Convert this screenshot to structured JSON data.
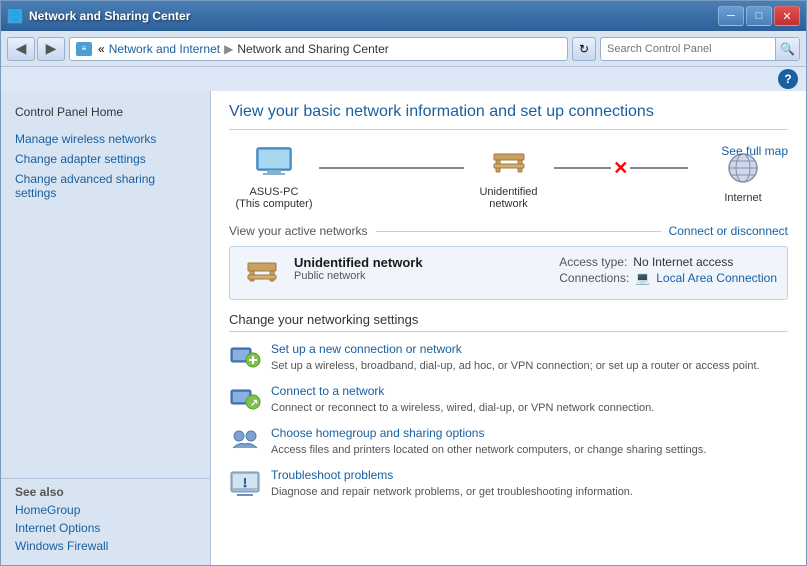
{
  "window": {
    "title": "Network and Sharing Center",
    "icon": "🌐",
    "controls": {
      "minimize": "─",
      "maximize": "□",
      "close": "✕"
    }
  },
  "addressbar": {
    "back": "◀",
    "forward": "▶",
    "breadcrumb": [
      "Network and Internet",
      "Network and Sharing Center"
    ],
    "refresh": "↻",
    "search_placeholder": "Search Control Panel"
  },
  "help": "?",
  "sidebar": {
    "home_label": "Control Panel Home",
    "links": [
      "Manage wireless networks",
      "Change adapter settings",
      "Change advanced sharing settings"
    ],
    "see_also": "See also",
    "bottom_links": [
      "HomeGroup",
      "Internet Options",
      "Windows Firewall"
    ]
  },
  "content": {
    "title": "View your basic network information and set up connections",
    "diagram": {
      "nodes": [
        {
          "label": "ASUS-PC\n(This computer)",
          "type": "computer"
        },
        {
          "label": "Unidentified network",
          "type": "network"
        },
        {
          "label": "Internet",
          "type": "globe"
        }
      ],
      "connections": [
        "line",
        "broken"
      ],
      "see_full_map": "See full map"
    },
    "active_networks": {
      "section_label": "View your active networks",
      "connect_disconnect": "Connect or disconnect",
      "network": {
        "name": "Unidentified network",
        "type": "Public network",
        "access_type_label": "Access type:",
        "access_type_value": "No Internet access",
        "connections_label": "Connections:",
        "connections_value": "Local Area Connection"
      }
    },
    "change_settings": {
      "title": "Change your networking settings",
      "items": [
        {
          "link": "Set up a new connection or network",
          "desc": "Set up a wireless, broadband, dial-up, ad hoc, or VPN connection; or set up a router or access point.",
          "icon_type": "setup"
        },
        {
          "link": "Connect to a network",
          "desc": "Connect or reconnect to a wireless, wired, dial-up, or VPN network connection.",
          "icon_type": "connect"
        },
        {
          "link": "Choose homegroup and sharing options",
          "desc": "Access files and printers located on other network computers, or change sharing settings.",
          "icon_type": "homegroup"
        },
        {
          "link": "Troubleshoot problems",
          "desc": "Diagnose and repair network problems, or get troubleshooting information.",
          "icon_type": "troubleshoot"
        }
      ]
    }
  }
}
